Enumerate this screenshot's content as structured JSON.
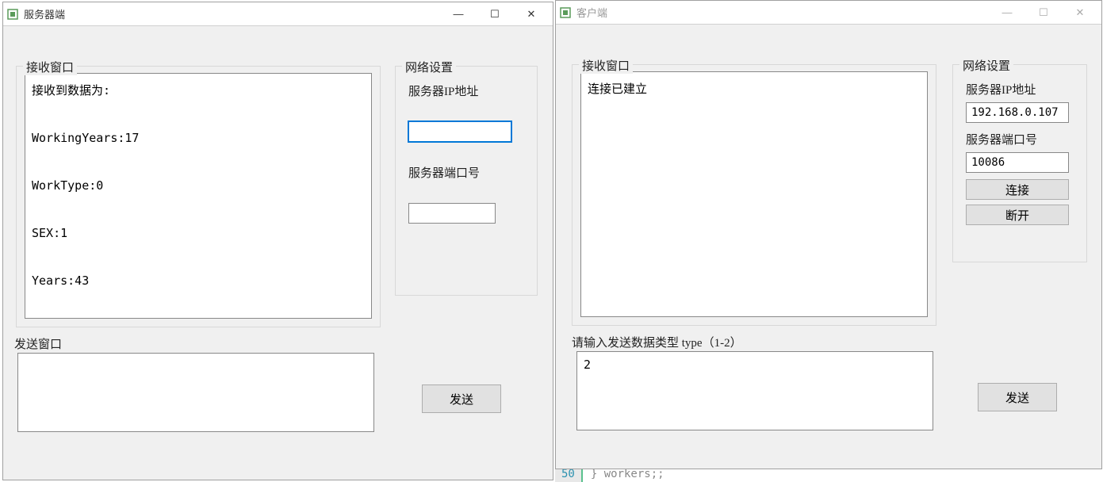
{
  "server_window": {
    "title": "服务器端",
    "receive_group_label": "接收窗口",
    "receive_text": "接收到数据为:\n\nWorkingYears:17\n\nWorkType:0\n\nSEX:1\n\nYears:43",
    "send_group_label": "发送窗口",
    "send_text": "",
    "network_group_label": "网络设置",
    "ip_label": "服务器IP地址",
    "ip_value": "",
    "port_label": "服务器端口号",
    "port_value": "",
    "send_button": "发送"
  },
  "client_window": {
    "title": "客户端",
    "receive_group_label": "接收窗口",
    "receive_text": "连接已建立",
    "send_group_label": "请输入发送数据类型 type（1-2）",
    "send_text": "2",
    "network_group_label": "网络设置",
    "ip_label": "服务器IP地址",
    "ip_value": "192.168.0.107",
    "port_label": "服务器端口号",
    "port_value": "10086",
    "connect_button": "连接",
    "disconnect_button": "断开",
    "send_button": "发送"
  },
  "background": {
    "line_num": "50",
    "code_text": "} workers;;"
  },
  "icons": {
    "minimize": "—",
    "maximize": "☐",
    "close": "✕"
  }
}
